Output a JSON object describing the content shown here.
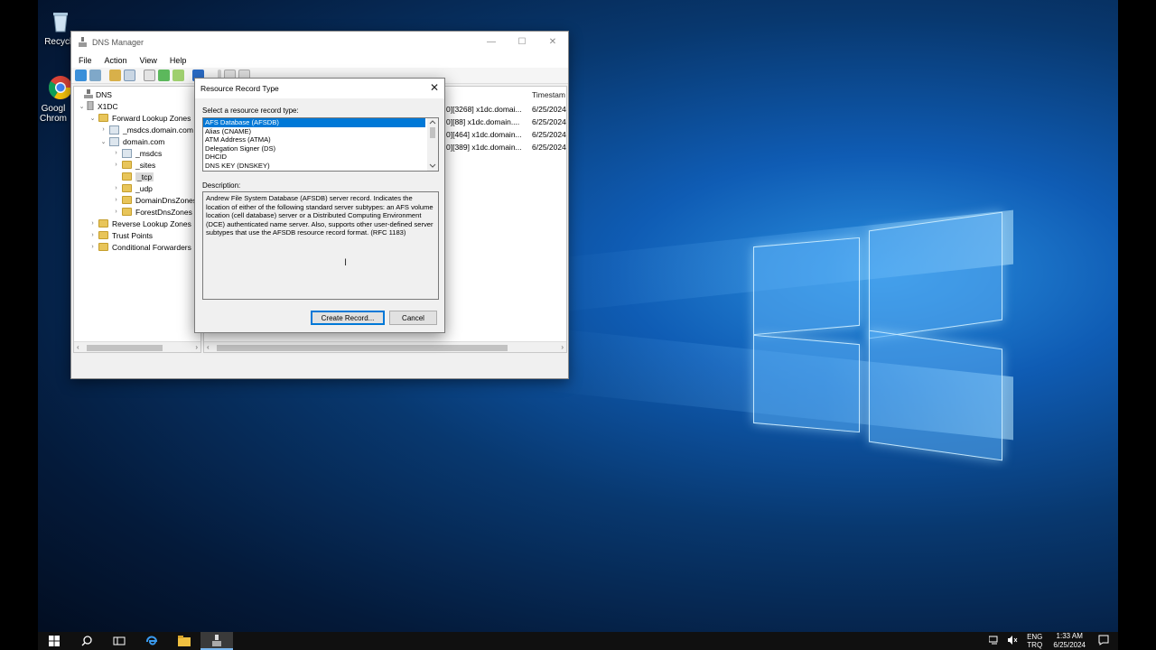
{
  "desktop": {
    "icons": [
      {
        "label": "Recycle"
      },
      {
        "label": "Googl Chrom"
      }
    ]
  },
  "dns_window": {
    "title": "DNS Manager",
    "controls": {
      "minimize": "—",
      "maximize": "☐",
      "close": "✕"
    },
    "menu": [
      "File",
      "Action",
      "View",
      "Help"
    ],
    "tree": [
      {
        "label": "DNS",
        "depth": 0,
        "expander": ""
      },
      {
        "label": "X1DC",
        "depth": 1,
        "expander": "⌄"
      },
      {
        "label": "Forward Lookup Zones",
        "depth": 2,
        "expander": "⌄"
      },
      {
        "label": "_msdcs.domain.com",
        "depth": 3,
        "expander": "›"
      },
      {
        "label": "domain.com",
        "depth": 3,
        "expander": "⌄"
      },
      {
        "label": "_msdcs",
        "depth": 4,
        "expander": "›"
      },
      {
        "label": "_sites",
        "depth": 4,
        "expander": "›"
      },
      {
        "label": "_tcp",
        "depth": 4,
        "expander": "",
        "selected": true
      },
      {
        "label": "_udp",
        "depth": 4,
        "expander": "›"
      },
      {
        "label": "DomainDnsZones",
        "depth": 4,
        "expander": "›"
      },
      {
        "label": "ForestDnsZones",
        "depth": 4,
        "expander": "›"
      },
      {
        "label": "Reverse Lookup Zones",
        "depth": 2,
        "expander": "›"
      },
      {
        "label": "Trust Points",
        "depth": 2,
        "expander": "›"
      },
      {
        "label": "Conditional Forwarders",
        "depth": 2,
        "expander": "›"
      }
    ],
    "list": {
      "header_timestamp": "Timestam",
      "rows": [
        {
          "data": "0][3268] x1dc.domai...",
          "timestamp": "6/25/2024"
        },
        {
          "data": "0][88] x1dc.domain....",
          "timestamp": "6/25/2024"
        },
        {
          "data": "0][464] x1dc.domain...",
          "timestamp": "6/25/2024"
        },
        {
          "data": "0][389] x1dc.domain...",
          "timestamp": "6/25/2024"
        }
      ]
    }
  },
  "dialog": {
    "title": "Resource Record Type",
    "close": "✕",
    "select_label": "Select a resource record type:",
    "record_types": [
      "AFS Database (AFSDB)",
      "Alias (CNAME)",
      "ATM Address (ATMA)",
      "Delegation Signer (DS)",
      "DHCID",
      "DNS KEY (DNSKEY)"
    ],
    "selected_index": 0,
    "description_label": "Description:",
    "description": "Andrew File System Database (AFSDB) server record. Indicates the location of either of the following standard server subtypes: an AFS volume location (cell database) server or a Distributed Computing Environment (DCE) authenticated name server. Also, supports other user-defined server subtypes that use the AFSDB resource record format. (RFC 1183)",
    "create_button": "Create Record...",
    "cancel_button": "Cancel"
  },
  "taskbar": {
    "language": "ENG",
    "language_sub": "TRQ",
    "time": "1:33 AM",
    "date": "6/25/2024"
  }
}
